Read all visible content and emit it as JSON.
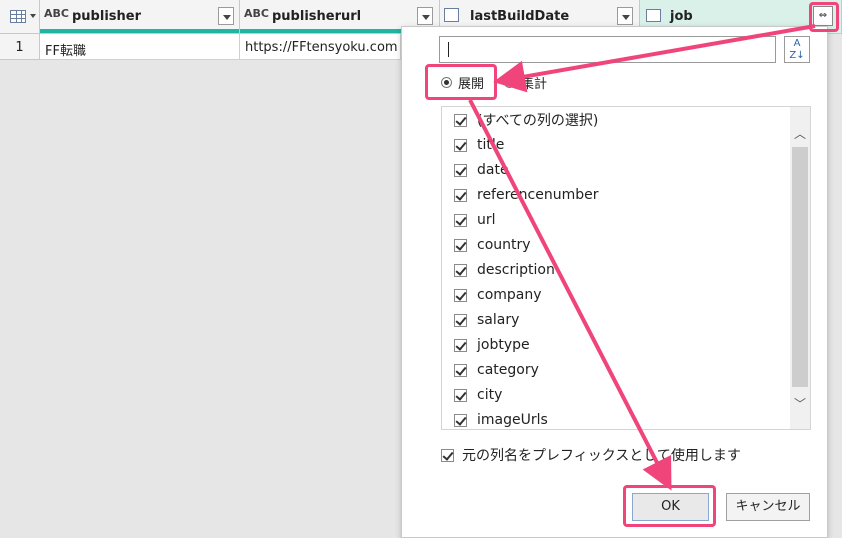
{
  "columns": [
    {
      "name": "publisher",
      "type_icon": "abc-text-icon"
    },
    {
      "name": "publisherurl",
      "type_icon": "abc-text-icon"
    },
    {
      "name": "lastBuildDate",
      "type_icon": "calendar-clock-icon"
    },
    {
      "name": "job",
      "type_icon": "table-icon"
    }
  ],
  "type_icon_text": "ABC",
  "row": {
    "number": "1",
    "publisher": "FF転職",
    "publisherurl": "https://FFtensyoku.com"
  },
  "popup": {
    "search_value": "",
    "radio_expand": "展開",
    "radio_aggregate": "集計",
    "items": [
      "(すべての列の選択)",
      "title",
      "date",
      "referencenumber",
      "url",
      "country",
      "description",
      "company",
      "salary",
      "jobtype",
      "category",
      "city",
      "imageUrls"
    ],
    "prefix_label": "元の列名をプレフィックスとして使用します",
    "ok_label": "OK",
    "cancel_label": "キャンセル"
  },
  "colors": {
    "highlight": "#f0457a",
    "teal_quality_bar": "#1fb5a5"
  }
}
